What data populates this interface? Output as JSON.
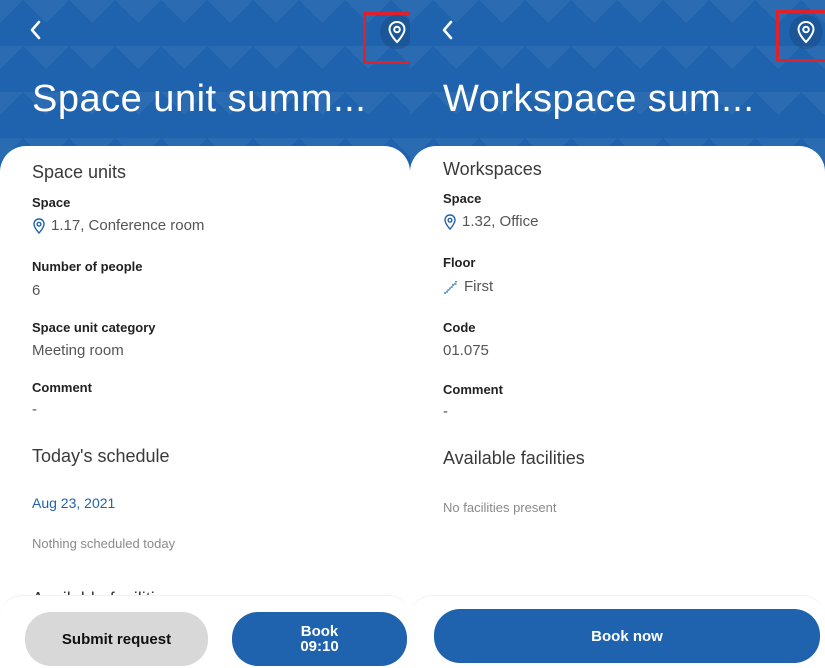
{
  "colors": {
    "header_blue": "#1f63ae",
    "highlight_red": "#e0202a",
    "date_blue": "#1f63ae"
  },
  "left": {
    "title": "Space unit summ...",
    "space_units": {
      "heading": "Space units",
      "space_label": "Space",
      "space_value": "1.17, Conference room",
      "people_label": "Number of people",
      "people_value": "6",
      "category_label": "Space unit category",
      "category_value": "Meeting room",
      "comment_label": "Comment",
      "comment_value": "-"
    },
    "schedule": {
      "heading": "Today's schedule",
      "date": "Aug 23, 2021",
      "empty": "Nothing scheduled today"
    },
    "facilities_heading": "Available facilities",
    "footer": {
      "submit_label": "Submit request",
      "book_label": "Book",
      "book_time": "09:10"
    }
  },
  "right": {
    "title": "Workspace sum...",
    "workspaces": {
      "heading": "Workspaces",
      "space_label": "Space",
      "space_value": "1.32, Office",
      "floor_label": "Floor",
      "floor_value": "First",
      "code_label": "Code",
      "code_value": "01.075",
      "comment_label": "Comment",
      "comment_value": "-"
    },
    "facilities": {
      "heading": "Available facilities",
      "empty": "No facilities present"
    },
    "footer": {
      "book_now_label": "Book now"
    }
  },
  "icons": {
    "back": "chevron-left-icon",
    "location": "map-pin-icon",
    "floor": "stairs-icon"
  }
}
